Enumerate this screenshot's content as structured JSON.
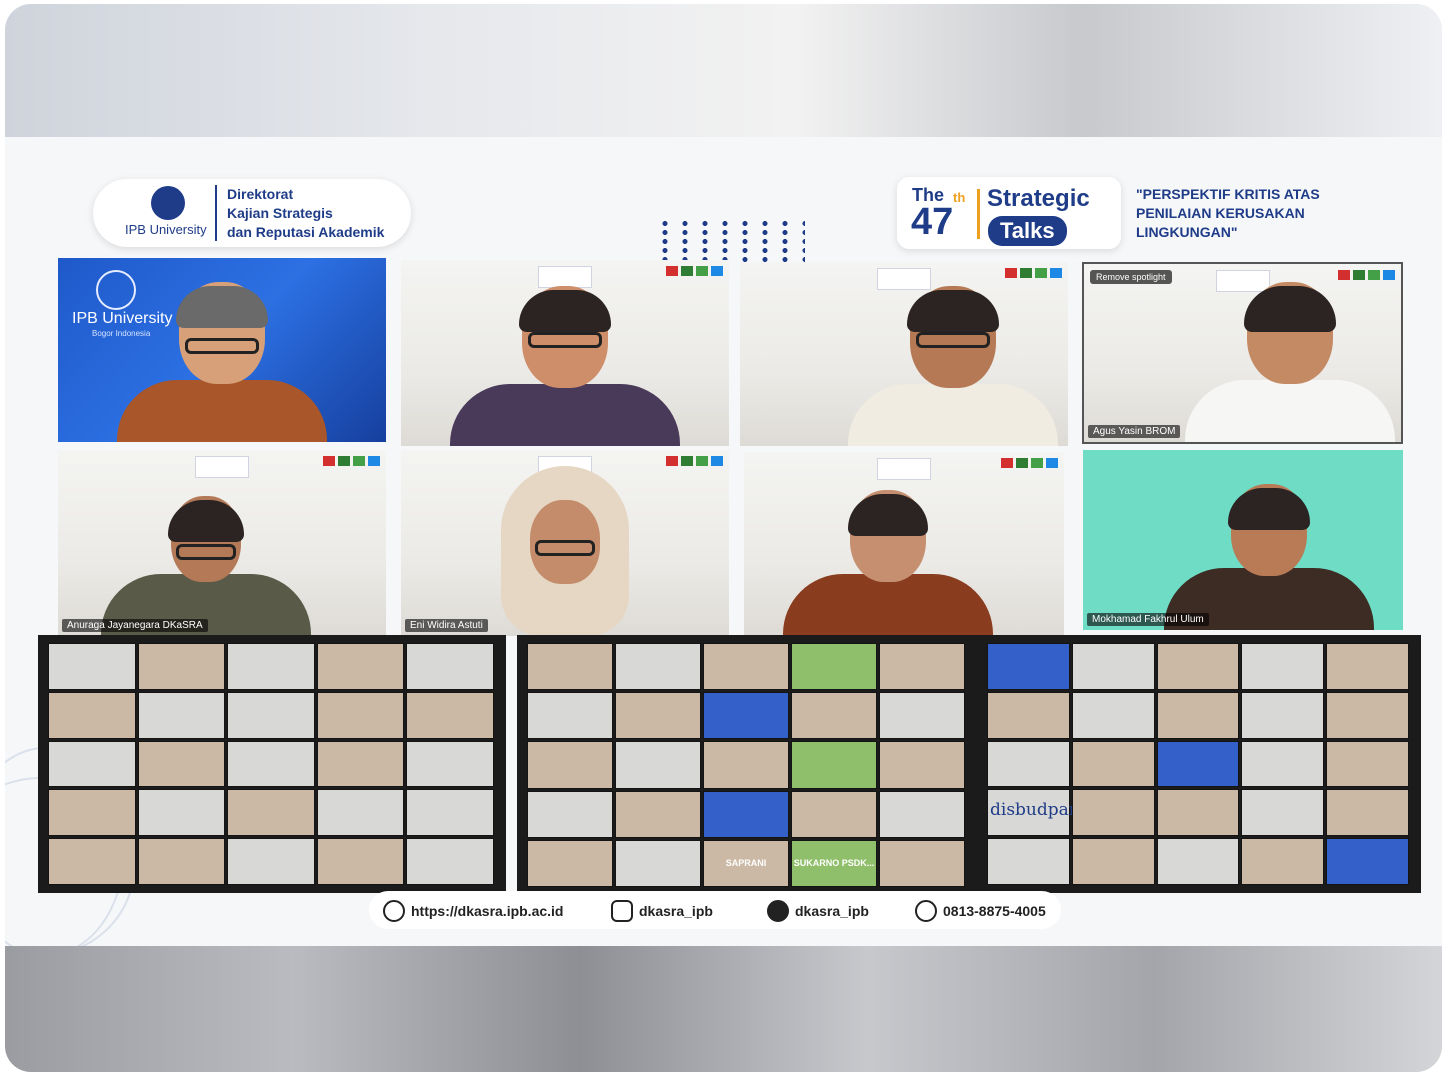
{
  "header": {
    "institution": "IPB University",
    "institution_sub": "Bogor Indonesia",
    "directorate_lines": [
      "Direktorat",
      "Kajian Strategis",
      "dan Reputasi Akademik"
    ]
  },
  "event": {
    "the": "The",
    "number": "47",
    "ordinal": "th",
    "strategic": "Strategic",
    "talks": "Talks",
    "topic": "\"PERSPEKTIF KRITIS ATAS PENILAIAN KERUSAKAN LINGKUNGAN\""
  },
  "speakers": [
    {
      "name": "",
      "style": "blue"
    },
    {
      "name": "",
      "style": "slide"
    },
    {
      "name": "",
      "style": "slide"
    },
    {
      "name": "Agus Yasin BROM",
      "style": "slide",
      "chip": "Remove spotlight"
    },
    {
      "name": "Anuraga Jayanegara DKaSRA",
      "style": "slide"
    },
    {
      "name": "Eni Widira Astuti",
      "style": "slide"
    },
    {
      "name": "",
      "style": "slide"
    },
    {
      "name": "Mokhamad Fakhrul Ulum",
      "style": "mint"
    }
  ],
  "galleries": {
    "middle_labels": [
      "SAPRANI",
      "SUKARNO PSDK..."
    ],
    "right_logo": "disbudpar"
  },
  "footer": {
    "website": "https://dkasra.ipb.ac.id",
    "instagram": "dkasra_ipb",
    "twitter": "dkasra_ipb",
    "phone": "0813-8875-4005"
  },
  "icons": [
    "globe-icon",
    "instagram-icon",
    "twitter-icon",
    "phone-icon"
  ]
}
